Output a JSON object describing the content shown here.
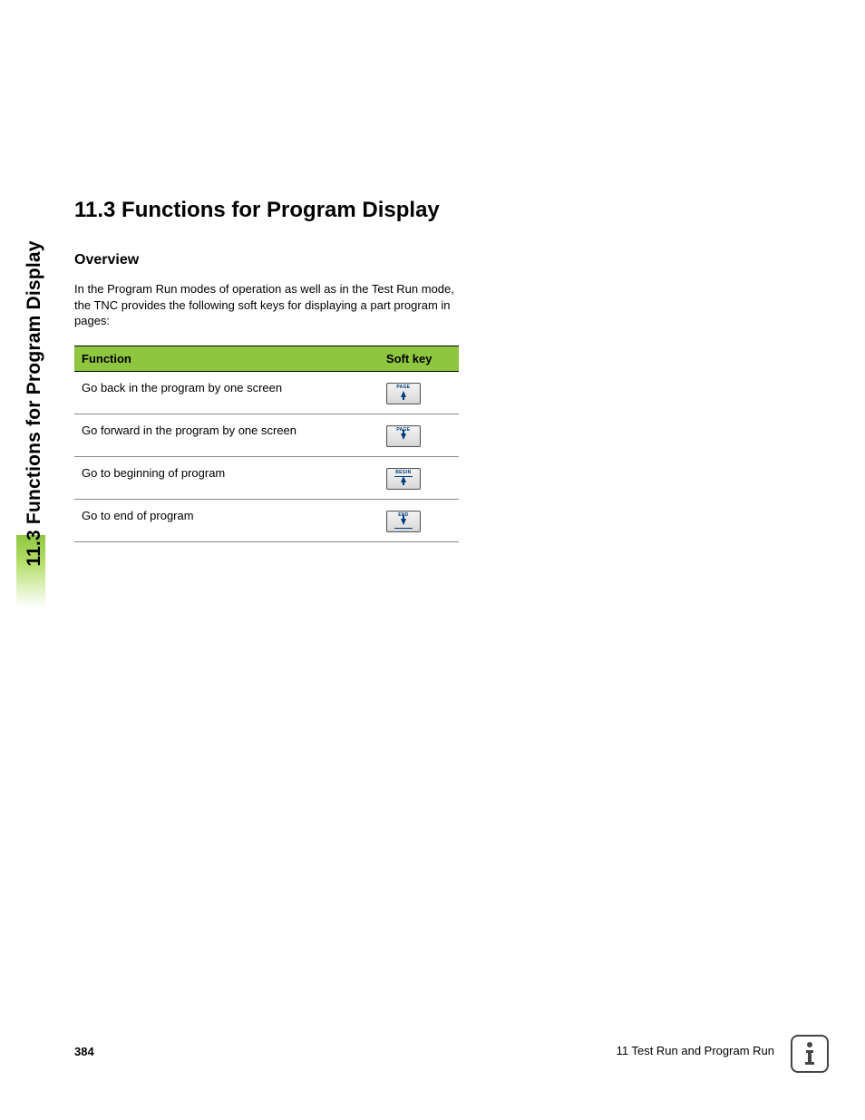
{
  "side_tab": "11.3 Functions for Program Display",
  "heading": "11.3 Functions for Program Display",
  "subheading": "Overview",
  "body": "In the Program Run modes of operation as well as in the Test Run mode, the TNC provides the following soft keys for displaying a part program in pages:",
  "table": {
    "head": {
      "function": "Function",
      "softkey": "Soft key"
    },
    "rows": [
      {
        "function": "Go back in the program by one screen",
        "key_label": "PAGE",
        "key_dir": "up",
        "key_line": "none"
      },
      {
        "function": "Go forward in the program by one screen",
        "key_label": "PAGE",
        "key_dir": "down",
        "key_line": "none"
      },
      {
        "function": "Go to beginning of program",
        "key_label": "BEGIN",
        "key_dir": "up",
        "key_line": "top"
      },
      {
        "function": "Go to end of program",
        "key_label": "END",
        "key_dir": "down",
        "key_line": "bottom"
      }
    ]
  },
  "footer": {
    "page": "384",
    "chapter": "11 Test Run and Program Run"
  }
}
